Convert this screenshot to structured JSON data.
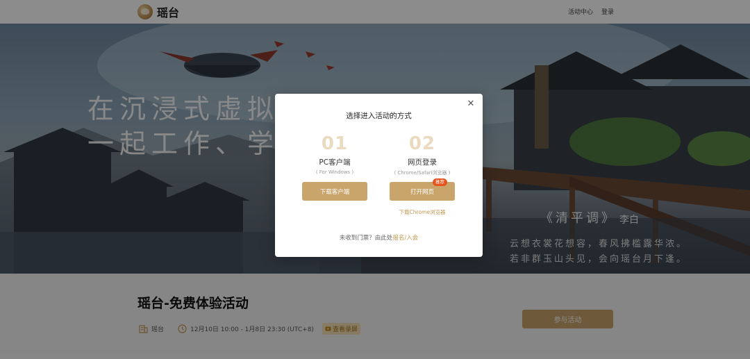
{
  "header": {
    "logo_text": "瑶台",
    "nav_activity": "活动中心",
    "nav_login": "登录"
  },
  "hero": {
    "title_line1": "在沉浸式虚拟世界中",
    "title_line2": "一起工作、学习",
    "poem_title": "《清平调》",
    "poem_author": "李白",
    "poem_line1": "云想衣裳花想容，春风拂槛露华浓。",
    "poem_line2": "若非群玉山头见，会向瑶台月下逢。"
  },
  "event": {
    "title": "瑶台-免费体验活动",
    "organizer": "瑶台",
    "time": "12月10日 10:00 - 1月8日 23:30 (UTC+8)",
    "badge": "查看录屏",
    "join_button": "参与活动"
  },
  "modal": {
    "title": "选择进入活动的方式",
    "close_icon": "close-icon",
    "option1": {
      "number": "01",
      "title": "PC客户端",
      "subtitle": "( For Windows )",
      "button": "下载客户端"
    },
    "option2": {
      "number": "02",
      "title": "网页登录",
      "subtitle": "( Chrome/Safari浏览器 )",
      "button": "打开网页",
      "badge": "推荐",
      "link": "下载Chrome浏览器"
    },
    "footer_prefix": "未收到门票？由此处",
    "footer_link": "报名/入会"
  },
  "colors": {
    "accent": "#c9a46b",
    "link": "#c49a52",
    "recommend_badge": "#e8541e"
  }
}
